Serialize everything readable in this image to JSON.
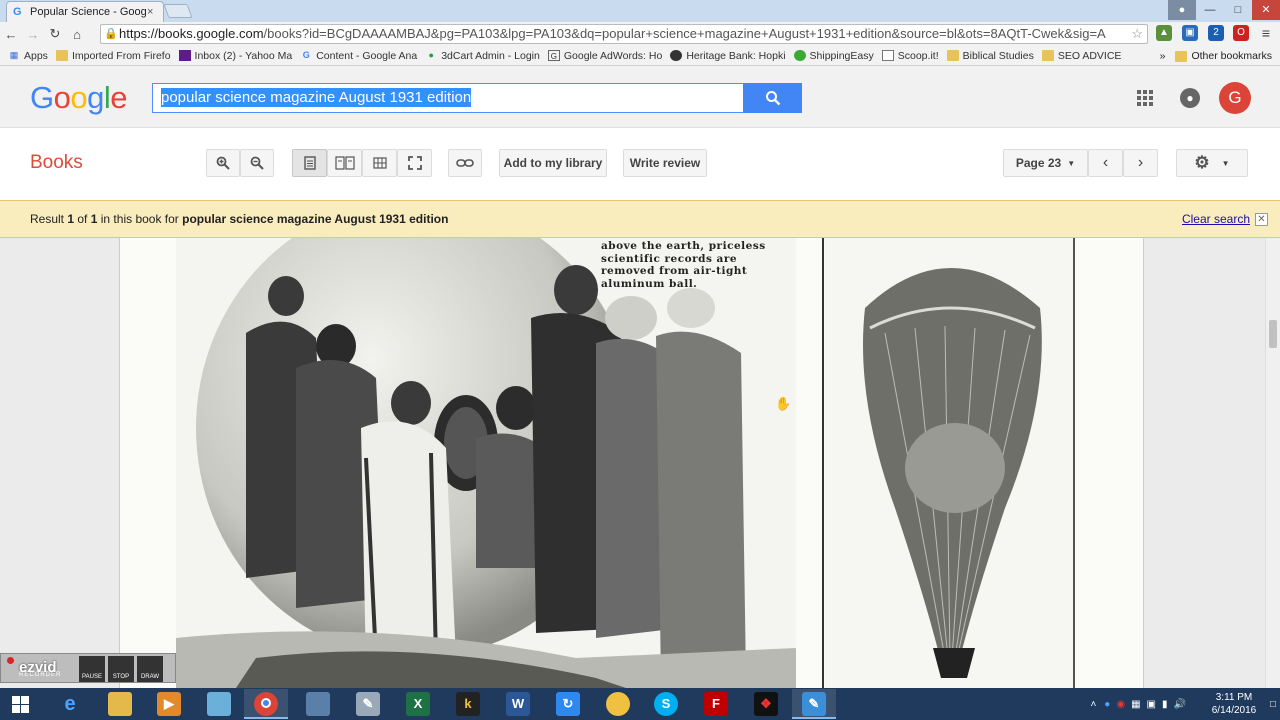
{
  "browser": {
    "tab_title": "Popular Science - Google",
    "tab_close": "×",
    "url_host": "https://books.google.com",
    "url_rest": "/books?id=BCgDAAAAMBAJ&pg=PA103&lpg=PA103&dq=popular+science+magazine+August+1931+edition&source=bl&ots=8AQtT-Cwek&sig=A",
    "bookmarks": [
      {
        "label": "Apps",
        "icon": "apps-grid-icon"
      },
      {
        "label": "Imported From Firefo",
        "icon": "folder-icon"
      },
      {
        "label": "Inbox (2) - Yahoo Ma",
        "icon": "yahoo-mail-icon"
      },
      {
        "label": "Content - Google Ana",
        "icon": "google-icon"
      },
      {
        "label": "3dCart Admin - Login",
        "icon": "3dcart-icon"
      },
      {
        "label": "Google AdWords: Ho",
        "icon": "adwords-icon"
      },
      {
        "label": "Heritage Bank: Hopki",
        "icon": "bank-icon"
      },
      {
        "label": "ShippingEasy",
        "icon": "shippingeasy-icon"
      },
      {
        "label": "Scoop.it!",
        "icon": "page-icon"
      },
      {
        "label": "Biblical Studies",
        "icon": "folder-icon"
      },
      {
        "label": "SEO ADVICE",
        "icon": "folder-icon"
      }
    ],
    "more_bookmarks": "»",
    "other_bookmarks": "Other bookmarks"
  },
  "google": {
    "logo": [
      "G",
      "o",
      "o",
      "g",
      "l",
      "e"
    ],
    "logo_colors": [
      "#4285f4",
      "#ea4335",
      "#fbbc05",
      "#4285f4",
      "#34a853",
      "#ea4335"
    ],
    "search_query": "popular science magazine August 1931 edition",
    "avatar_letter": "G"
  },
  "books": {
    "title": "Books",
    "add_library": "Add to my library",
    "write_review": "Write review",
    "page_label": "Page 23"
  },
  "result": {
    "prefix": "Result ",
    "num": "1",
    "of": " of ",
    "total": "1",
    "middle": " in this book for ",
    "query": "popular science magazine August 1931 edition",
    "clear": "Clear search"
  },
  "page_content": {
    "caption": "above the earth, priceless scientific records are removed from air-tight aluminum ball."
  },
  "ezvid": {
    "brand": "ezvid",
    "sub": "RECORDER",
    "pause": "PAUSE",
    "stop": "STOP",
    "draw": "DRAW"
  },
  "taskbar": {
    "time": "3:11 PM",
    "date": "6/14/2016"
  },
  "colors": {
    "accent_blue": "#4285f4",
    "books_red": "#dd4b39",
    "result_bg": "#f9edbe"
  }
}
